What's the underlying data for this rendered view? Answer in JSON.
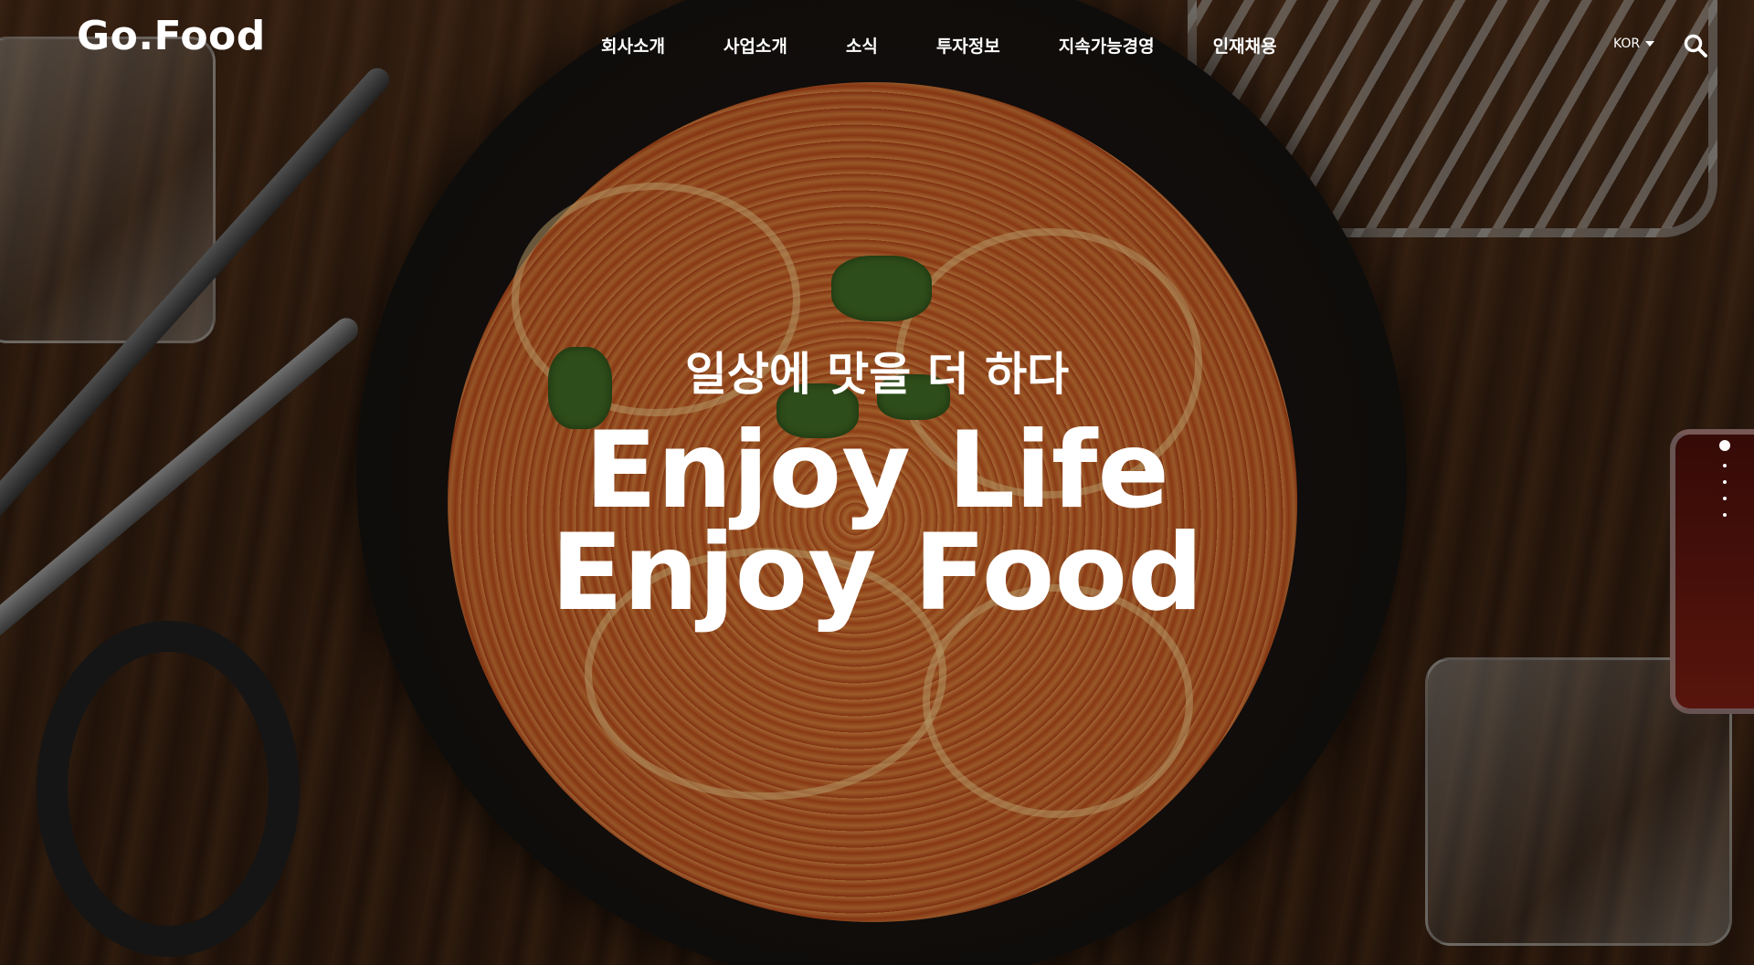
{
  "header": {
    "logo": "Go.Food",
    "nav": [
      {
        "label": "회사소개"
      },
      {
        "label": "사업소개"
      },
      {
        "label": "소식"
      },
      {
        "label": "투자정보"
      },
      {
        "label": "지속가능경영"
      },
      {
        "label": "인재채용"
      }
    ],
    "language": "KOR",
    "search_icon": "search-icon"
  },
  "hero": {
    "subtitle": "일상에 맛을 더 하다",
    "headline_line1": "Enjoy Life",
    "headline_line2": "Enjoy Food"
  },
  "pager": {
    "total": 5,
    "active_index": 0
  },
  "colors": {
    "text": "#ffffff",
    "background_wood": "#2b1a0f",
    "broth": "#b8501f"
  }
}
